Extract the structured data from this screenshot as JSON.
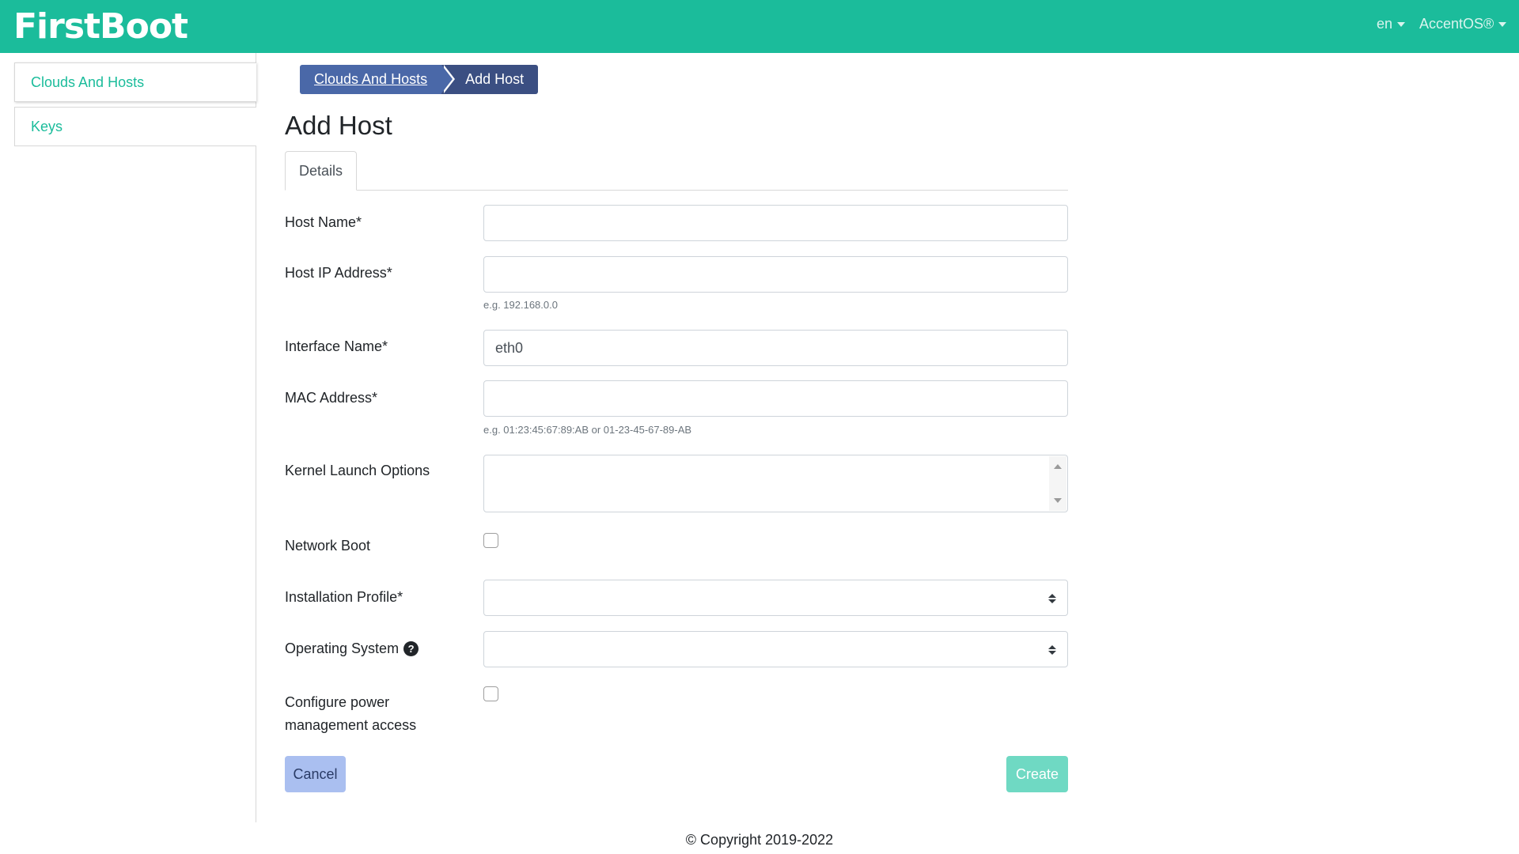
{
  "header": {
    "brand": "FirstBoot",
    "language": "en",
    "user": "AccentOS®"
  },
  "sidebar": {
    "items": [
      {
        "label": "Clouds And Hosts"
      },
      {
        "label": "Keys"
      }
    ]
  },
  "breadcrumb": {
    "items": [
      "Clouds And Hosts",
      "Add Host"
    ]
  },
  "page": {
    "title": "Add Host",
    "tab": "Details"
  },
  "form": {
    "host_name": {
      "label": "Host Name*",
      "value": ""
    },
    "host_ip": {
      "label": "Host IP Address*",
      "value": "",
      "help": "e.g. 192.168.0.0"
    },
    "interface_name": {
      "label": "Interface Name*",
      "value": "eth0"
    },
    "mac_address": {
      "label": "MAC Address*",
      "value": "",
      "help": "e.g. 01:23:45:67:89:AB or 01-23-45-67-89-AB"
    },
    "kernel_options": {
      "label": "Kernel Launch Options",
      "value": ""
    },
    "network_boot": {
      "label": "Network Boot",
      "checked": false
    },
    "installation_profile": {
      "label": "Installation Profile*",
      "value": ""
    },
    "operating_system": {
      "label": "Operating System",
      "value": "",
      "help_icon": "question-circle-icon"
    },
    "power_management": {
      "label": "Configure power management access",
      "checked": false
    }
  },
  "actions": {
    "cancel": "Cancel",
    "create": "Create"
  },
  "footer": {
    "copyright": "© Copyright 2019-2022"
  },
  "colors": {
    "brand": "#1bbc9b",
    "breadcrumb_link": "#4a68a8",
    "breadcrumb_current": "#3b4f82",
    "cancel_button": "#aabff0",
    "create_button": "#6fd9c3"
  }
}
